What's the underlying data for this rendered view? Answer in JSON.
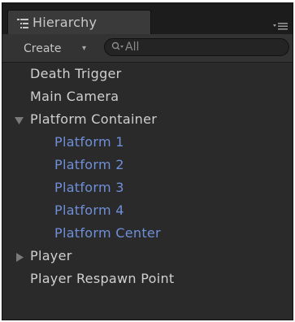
{
  "panel": {
    "tab_label": "Hierarchy",
    "tab_icon": "hierarchy-list-icon",
    "menu_icon": "panel-menu-icon"
  },
  "toolbar": {
    "create_label": "Create",
    "create_arrow": "▾",
    "search_placeholder": "All",
    "search_icon": "search-icon"
  },
  "tree": {
    "items": [
      {
        "label": "Death Trigger",
        "depth": 0,
        "expander": "none",
        "prefab": false
      },
      {
        "label": "Main Camera",
        "depth": 0,
        "expander": "none",
        "prefab": false
      },
      {
        "label": "Platform Container",
        "depth": 0,
        "expander": "expanded",
        "prefab": false
      },
      {
        "label": "Platform 1",
        "depth": 1,
        "expander": "none",
        "prefab": true
      },
      {
        "label": "Platform 2",
        "depth": 1,
        "expander": "none",
        "prefab": true
      },
      {
        "label": "Platform 3",
        "depth": 1,
        "expander": "none",
        "prefab": true
      },
      {
        "label": "Platform 4",
        "depth": 1,
        "expander": "none",
        "prefab": true
      },
      {
        "label": "Platform Center",
        "depth": 1,
        "expander": "none",
        "prefab": true
      },
      {
        "label": "Player",
        "depth": 0,
        "expander": "collapsed",
        "prefab": false
      },
      {
        "label": "Player Respawn Point",
        "depth": 0,
        "expander": "none",
        "prefab": false
      }
    ]
  },
  "colors": {
    "background": "#2a2a2a",
    "text": "#d0d0d0",
    "prefab_text": "#6f8fd8",
    "expander": "#7a7a7a"
  }
}
